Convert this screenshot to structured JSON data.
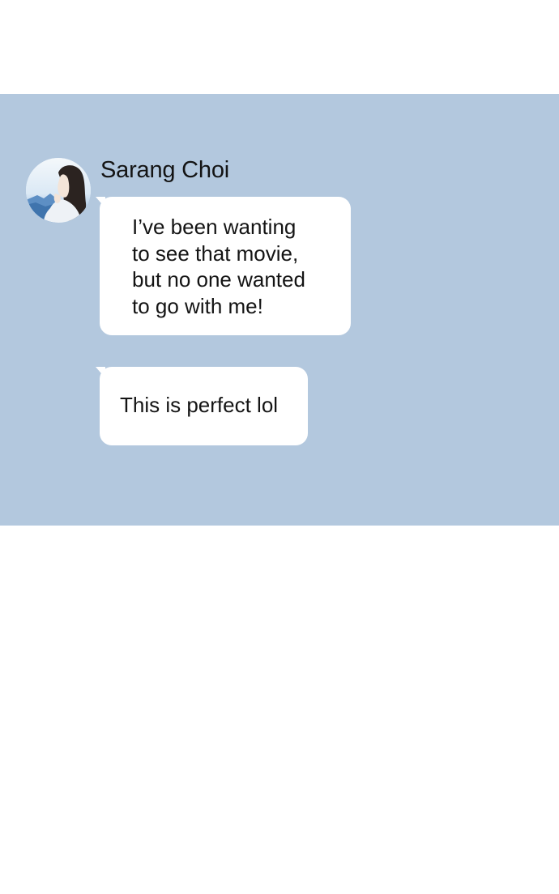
{
  "chat": {
    "sender_name": "Sarang Choi",
    "messages": [
      {
        "lines": [
          "I’ve been wanting",
          "to see that movie,",
          "but no one wanted",
          "to go with me!"
        ]
      },
      {
        "text": "This is perfect lol"
      }
    ]
  },
  "colors": {
    "panel_background": "#b3c8de",
    "bubble_background": "#ffffff",
    "page_background": "#ffffff",
    "text": "#141414"
  }
}
